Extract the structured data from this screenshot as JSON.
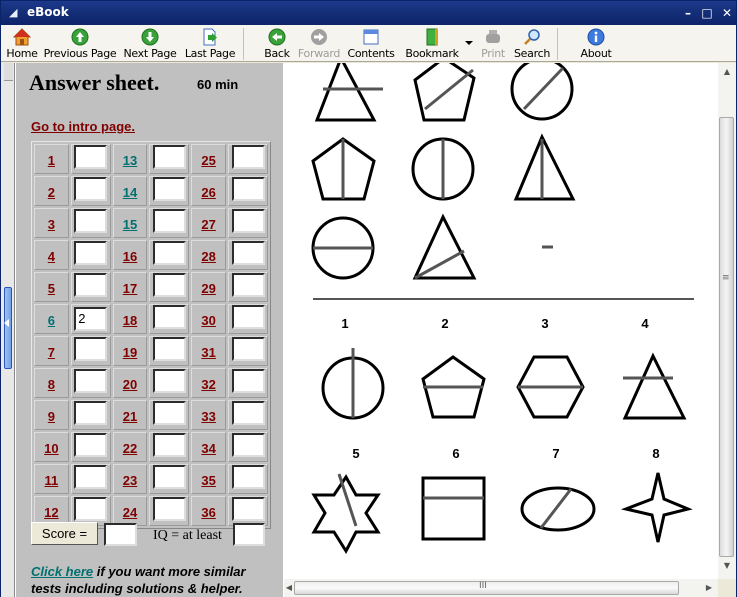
{
  "window": {
    "title": "eBook",
    "controls": {
      "minimize": "–",
      "maximize": "□",
      "close": "✕"
    }
  },
  "toolbar": {
    "items": [
      {
        "label": "Home",
        "icon": "home-icon",
        "enabled": true
      },
      {
        "label": "Previous Page",
        "icon": "arrow-up-icon",
        "enabled": true
      },
      {
        "label": "Next Page",
        "icon": "arrow-down-icon",
        "enabled": true
      },
      {
        "label": "Last Page",
        "icon": "last-page-icon",
        "enabled": true
      },
      {
        "label": "Back",
        "icon": "arrow-left-icon",
        "enabled": true
      },
      {
        "label": "Forward",
        "icon": "arrow-right-icon",
        "enabled": false
      },
      {
        "label": "Contents",
        "icon": "contents-icon",
        "enabled": true
      },
      {
        "label": "Bookmark",
        "icon": "bookmark-icon",
        "enabled": true
      },
      {
        "label": "Print",
        "icon": "print-icon",
        "enabled": false
      },
      {
        "label": "Search",
        "icon": "search-icon",
        "enabled": true
      },
      {
        "label": "About",
        "icon": "info-icon",
        "enabled": true
      }
    ]
  },
  "answer_sheet": {
    "title": "Answer sheet.",
    "timer": "60 min",
    "intro_link": "Go to intro page.",
    "questions": [
      {
        "n": "1",
        "visited": false,
        "answer": ""
      },
      {
        "n": "2",
        "visited": false,
        "answer": ""
      },
      {
        "n": "3",
        "visited": false,
        "answer": ""
      },
      {
        "n": "4",
        "visited": false,
        "answer": ""
      },
      {
        "n": "5",
        "visited": false,
        "answer": ""
      },
      {
        "n": "6",
        "visited": true,
        "answer": "2"
      },
      {
        "n": "7",
        "visited": false,
        "answer": ""
      },
      {
        "n": "8",
        "visited": false,
        "answer": ""
      },
      {
        "n": "9",
        "visited": false,
        "answer": ""
      },
      {
        "n": "10",
        "visited": false,
        "answer": ""
      },
      {
        "n": "11",
        "visited": false,
        "answer": ""
      },
      {
        "n": "12",
        "visited": false,
        "answer": ""
      },
      {
        "n": "13",
        "visited": true,
        "answer": ""
      },
      {
        "n": "14",
        "visited": true,
        "answer": ""
      },
      {
        "n": "15",
        "visited": true,
        "answer": ""
      },
      {
        "n": "16",
        "visited": false,
        "answer": ""
      },
      {
        "n": "17",
        "visited": false,
        "answer": ""
      },
      {
        "n": "18",
        "visited": false,
        "answer": ""
      },
      {
        "n": "19",
        "visited": false,
        "answer": ""
      },
      {
        "n": "20",
        "visited": false,
        "answer": ""
      },
      {
        "n": "21",
        "visited": false,
        "answer": ""
      },
      {
        "n": "22",
        "visited": false,
        "answer": ""
      },
      {
        "n": "23",
        "visited": false,
        "answer": ""
      },
      {
        "n": "24",
        "visited": false,
        "answer": ""
      },
      {
        "n": "25",
        "visited": false,
        "answer": ""
      },
      {
        "n": "26",
        "visited": false,
        "answer": ""
      },
      {
        "n": "27",
        "visited": false,
        "answer": ""
      },
      {
        "n": "28",
        "visited": false,
        "answer": ""
      },
      {
        "n": "29",
        "visited": false,
        "answer": ""
      },
      {
        "n": "30",
        "visited": false,
        "answer": ""
      },
      {
        "n": "31",
        "visited": false,
        "answer": ""
      },
      {
        "n": "32",
        "visited": false,
        "answer": ""
      },
      {
        "n": "33",
        "visited": false,
        "answer": ""
      },
      {
        "n": "34",
        "visited": false,
        "answer": ""
      },
      {
        "n": "35",
        "visited": false,
        "answer": ""
      },
      {
        "n": "36",
        "visited": false,
        "answer": ""
      }
    ],
    "score_button": "Score =",
    "score_value": "",
    "iq_label": "IQ = at least",
    "iq_value": "",
    "more_link": "Click here",
    "more_text": " if you want more similar tests including solutions & helper."
  },
  "puzzle": {
    "matrix": [
      [
        "triangle-horizontal-line",
        "pentagon-diagonal-line",
        "circle-diagonal-line"
      ],
      [
        "pentagon-vertical-line",
        "circle-vertical-line",
        "triangle-vertical-line"
      ],
      [
        "circle-horizontal-line",
        "triangle-slanted-line",
        "missing"
      ]
    ],
    "options": [
      {
        "label": "1",
        "shape": "circle-vertical-line-extended"
      },
      {
        "label": "2",
        "shape": "pentagon-horizontal-line"
      },
      {
        "label": "3",
        "shape": "hexagon-horizontal-line"
      },
      {
        "label": "4",
        "shape": "triangle-horizontal-line-extended"
      },
      {
        "label": "5",
        "shape": "star-diagonal-line"
      },
      {
        "label": "6",
        "shape": "square-horizontal-line"
      },
      {
        "label": "7",
        "shape": "ellipse-diagonal-line"
      },
      {
        "label": "8",
        "shape": "four-point-star"
      }
    ]
  }
}
